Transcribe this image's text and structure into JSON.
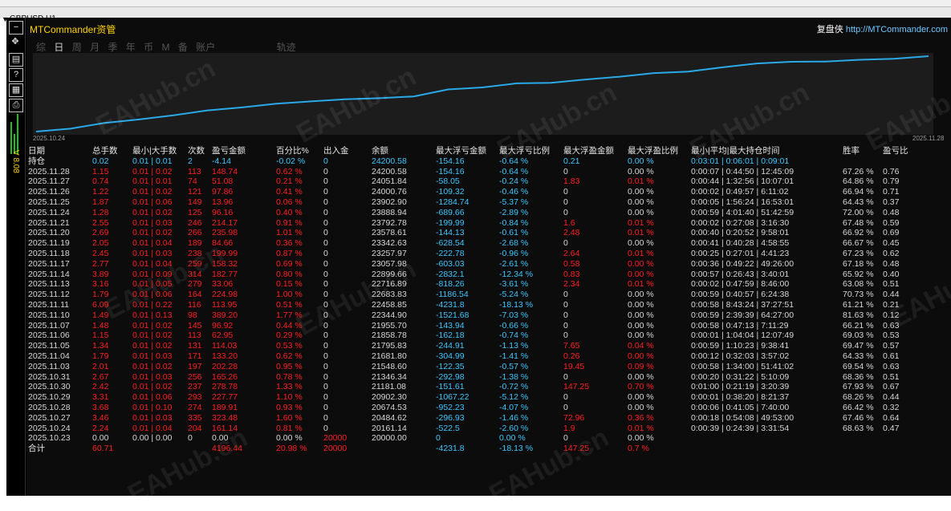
{
  "window": {
    "title": "GBPUSD,H1"
  },
  "app": {
    "title": "MTCommander资管",
    "brand_label": "复盘侠",
    "brand_url": "http://MTCommander.com",
    "version": "V 8.08"
  },
  "toolbar_icons": [
    "minimize-icon",
    "move-icon",
    "layout-icon",
    "help-icon",
    "settings-icon",
    "print-icon"
  ],
  "tabs": [
    "综",
    "日",
    "周",
    "月",
    "季",
    "年",
    "币",
    "M",
    "备",
    "账户",
    "轨迹"
  ],
  "active_tab": "日",
  "plot": {
    "start_date": "2025.10.24",
    "end_date": "2025.11.28",
    "line_color": "#29a9e8",
    "series": [
      20000,
      20161.14,
      20484.62,
      20674.53,
      20902.3,
      21181.08,
      21346.34,
      21548.6,
      21681.8,
      21795.83,
      21858.78,
      21955.7,
      22344.9,
      22458.85,
      22683.83,
      22716.89,
      22899.66,
      23057.98,
      23257.97,
      23342.63,
      23578.61,
      23792.78,
      23888.94,
      23902.9,
      24000.76,
      24051.84,
      24200.58
    ]
  },
  "watermark": "EAHub.cn",
  "headers": [
    "日期",
    "总手数",
    "最小|大手数",
    "次数",
    "盈亏金额",
    "百分比%",
    "出入金",
    "余额",
    "最大浮亏金额",
    "最大浮亏比例",
    "最大浮盈金额",
    "最大浮盈比例",
    "最小|平均|最大持仓时间",
    "胜率",
    "盈亏比"
  ],
  "holding": {
    "date": "持仓",
    "lots": "0.02",
    "minmax": "0.01 | 0.01",
    "count": "2",
    "pnl": "-4.14",
    "pct": "-0.02 %",
    "deposit": "0",
    "balance": "24200.58",
    "mfl": "-154.16",
    "mflp": "-0.64 %",
    "mfp": "0.21",
    "mfpp": "0.00 %",
    "hold": "0:03:01 | 0:06:01 | 0:09:01",
    "win": "",
    "pl": ""
  },
  "rows": [
    {
      "date": "2025.11.28",
      "lots": "1.15",
      "minmax": "0.01 | 0.02",
      "count": "113",
      "pnl": "148.74",
      "pct": "0.62 %",
      "deposit": "0",
      "balance": "24200.58",
      "mfl": "-154.16",
      "mflp": "-0.64 %",
      "mfp": "0",
      "mfpp": "0.00 %",
      "hold": "0:00:07 | 0:44:50 | 12:45:09",
      "win": "67.26 %",
      "pl": "0.76"
    },
    {
      "date": "2025.11.27",
      "lots": "0.74",
      "minmax": "0.01 | 0.01",
      "count": "74",
      "pnl": "51.08",
      "pct": "0.21 %",
      "deposit": "0",
      "balance": "24051.84",
      "mfl": "-58.05",
      "mflp": "-0.24 %",
      "mfp": "1.83",
      "mfpp": "0.01 %",
      "hold": "0:00:44 | 1:32:56 | 10:07:01",
      "win": "64.86 %",
      "pl": "0.79"
    },
    {
      "date": "2025.11.26",
      "lots": "1.22",
      "minmax": "0.01 | 0.02",
      "count": "121",
      "pnl": "97.86",
      "pct": "0.41 %",
      "deposit": "0",
      "balance": "24000.76",
      "mfl": "-109.32",
      "mflp": "-0.46 %",
      "mfp": "0",
      "mfpp": "0.00 %",
      "hold": "0:00:02 | 0:49:57 | 6:11:02",
      "win": "66.94 %",
      "pl": "0.71"
    },
    {
      "date": "2025.11.25",
      "lots": "1.87",
      "minmax": "0.01 | 0.06",
      "count": "149",
      "pnl": "13.96",
      "pct": "0.06 %",
      "deposit": "0",
      "balance": "23902.90",
      "mfl": "-1284.74",
      "mflp": "-5.37 %",
      "mfp": "0",
      "mfpp": "0.00 %",
      "hold": "0:00:05 | 1:56:24 | 16:53:01",
      "win": "64.43 %",
      "pl": "0.37"
    },
    {
      "date": "2025.11.24",
      "lots": "1.28",
      "minmax": "0.01 | 0.02",
      "count": "125",
      "pnl": "96.16",
      "pct": "0.40 %",
      "deposit": "0",
      "balance": "23888.94",
      "mfl": "-689.66",
      "mflp": "-2.89 %",
      "mfp": "0",
      "mfpp": "0.00 %",
      "hold": "0:00:59 | 4:01:40 | 51:42:59",
      "win": "72.00 %",
      "pl": "0.48"
    },
    {
      "date": "2025.11.21",
      "lots": "2.55",
      "minmax": "0.01 | 0.03",
      "count": "246",
      "pnl": "214.17",
      "pct": "0.91 %",
      "deposit": "0",
      "balance": "23792.78",
      "mfl": "-199.99",
      "mflp": "-0.84 %",
      "mfp": "1.6",
      "mfpp": "0.01 %",
      "hold": "0:00:02 | 0:27:08 | 3:16:30",
      "win": "67.48 %",
      "pl": "0.59"
    },
    {
      "date": "2025.11.20",
      "lots": "2.69",
      "minmax": "0.01 | 0.02",
      "count": "266",
      "pnl": "235.98",
      "pct": "1.01 %",
      "deposit": "0",
      "balance": "23578.61",
      "mfl": "-144.13",
      "mflp": "-0.61 %",
      "mfp": "2.48",
      "mfpp": "0.01 %",
      "hold": "0:00:40 | 0:20:52 | 9:58:01",
      "win": "66.92 %",
      "pl": "0.69"
    },
    {
      "date": "2025.11.19",
      "lots": "2.05",
      "minmax": "0.01 | 0.04",
      "count": "189",
      "pnl": "84.66",
      "pct": "0.36 %",
      "deposit": "0",
      "balance": "23342.63",
      "mfl": "-628.54",
      "mflp": "-2.68 %",
      "mfp": "0",
      "mfpp": "0.00 %",
      "hold": "0:00:41 | 0:40:28 | 4:58:55",
      "win": "66.67 %",
      "pl": "0.45"
    },
    {
      "date": "2025.11.18",
      "lots": "2.45",
      "minmax": "0.01 | 0.03",
      "count": "238",
      "pnl": "199.99",
      "pct": "0.87 %",
      "deposit": "0",
      "balance": "23257.97",
      "mfl": "-222.78",
      "mflp": "-0.96 %",
      "mfp": "2.64",
      "mfpp": "0.01 %",
      "hold": "0:00:25 | 0:27:01 | 4:41:23",
      "win": "67.23 %",
      "pl": "0.62"
    },
    {
      "date": "2025.11.17",
      "lots": "2.77",
      "minmax": "0.01 | 0.04",
      "count": "259",
      "pnl": "158.32",
      "pct": "0.69 %",
      "deposit": "0",
      "balance": "23057.98",
      "mfl": "-603.03",
      "mflp": "-2.61 %",
      "mfp": "0.58",
      "mfpp": "0.00 %",
      "hold": "0:00:36 | 0:49:22 | 49:26:00",
      "win": "67.18 %",
      "pl": "0.48"
    },
    {
      "date": "2025.11.14",
      "lots": "3.89",
      "minmax": "0.01 | 0.09",
      "count": "314",
      "pnl": "182.77",
      "pct": "0.80 %",
      "deposit": "0",
      "balance": "22899.66",
      "mfl": "-2832.1",
      "mflp": "-12.34 %",
      "mfp": "0.83",
      "mfpp": "0.00 %",
      "hold": "0:00:57 | 0:26:43 | 3:40:01",
      "win": "65.92 %",
      "pl": "0.40"
    },
    {
      "date": "2025.11.13",
      "lots": "3.16",
      "minmax": "0.01 | 0.05",
      "count": "279",
      "pnl": "33.06",
      "pct": "0.15 %",
      "deposit": "0",
      "balance": "22716.89",
      "mfl": "-818.26",
      "mflp": "-3.61 %",
      "mfp": "2.34",
      "mfpp": "0.01 %",
      "hold": "0:00:02 | 0:47:59 | 8:46:00",
      "win": "63.08 %",
      "pl": "0.51"
    },
    {
      "date": "2025.11.12",
      "lots": "1.79",
      "minmax": "0.01 | 0.06",
      "count": "164",
      "pnl": "224.98",
      "pct": "1.00 %",
      "deposit": "0",
      "balance": "22683.83",
      "mfl": "-1186.54",
      "mflp": "-5.24 %",
      "mfp": "0",
      "mfpp": "0.00 %",
      "hold": "0:00:59 | 0:40:57 | 6:24:38",
      "win": "70.73 %",
      "pl": "0.44"
    },
    {
      "date": "2025.11.11",
      "lots": "6.09",
      "minmax": "0.01 | 0.22",
      "count": "116",
      "pnl": "113.95",
      "pct": "0.51 %",
      "deposit": "0",
      "balance": "22458.85",
      "mfl": "-4231.8",
      "mflp": "-18.13 %",
      "mfp": "0",
      "mfpp": "0.00 %",
      "hold": "0:00:58 | 8:43:24 | 37:27:51",
      "win": "61.21 %",
      "pl": "0.21"
    },
    {
      "date": "2025.11.10",
      "lots": "1.49",
      "minmax": "0.01 | 0.13",
      "count": "98",
      "pnl": "389.20",
      "pct": "1.77 %",
      "deposit": "0",
      "balance": "22344.90",
      "mfl": "-1521.68",
      "mflp": "-7.03 %",
      "mfp": "0",
      "mfpp": "0.00 %",
      "hold": "0:00:59 | 2:39:39 | 64:27:00",
      "win": "81.63 %",
      "pl": "0.12"
    },
    {
      "date": "2025.11.07",
      "lots": "1.48",
      "minmax": "0.01 | 0.02",
      "count": "145",
      "pnl": "96.92",
      "pct": "0.44 %",
      "deposit": "0",
      "balance": "21955.70",
      "mfl": "-143.94",
      "mflp": "-0.66 %",
      "mfp": "0",
      "mfpp": "0.00 %",
      "hold": "0:00:58 | 0:47:13 | 7:11:29",
      "win": "66.21 %",
      "pl": "0.63"
    },
    {
      "date": "2025.11.06",
      "lots": "1.15",
      "minmax": "0.01 | 0.02",
      "count": "113",
      "pnl": "62.95",
      "pct": "0.29 %",
      "deposit": "0",
      "balance": "21858.78",
      "mfl": "-162.18",
      "mflp": "-0.74 %",
      "mfp": "0",
      "mfpp": "0.00 %",
      "hold": "0:00:01 | 1:04:04 | 12:07:49",
      "win": "69.03 %",
      "pl": "0.53"
    },
    {
      "date": "2025.11.05",
      "lots": "1.34",
      "minmax": "0.01 | 0.02",
      "count": "131",
      "pnl": "114.03",
      "pct": "0.53 %",
      "deposit": "0",
      "balance": "21795.83",
      "mfl": "-244.91",
      "mflp": "-1.13 %",
      "mfp": "7.65",
      "mfpp": "0.04 %",
      "hold": "0:00:59 | 1:10:23 | 9:38:41",
      "win": "69.47 %",
      "pl": "0.57"
    },
    {
      "date": "2025.11.04",
      "lots": "1.79",
      "minmax": "0.01 | 0.03",
      "count": "171",
      "pnl": "133.20",
      "pct": "0.62 %",
      "deposit": "0",
      "balance": "21681.80",
      "mfl": "-304.99",
      "mflp": "-1.41 %",
      "mfp": "0.26",
      "mfpp": "0.00 %",
      "hold": "0:00:12 | 0:32:03 | 3:57:02",
      "win": "64.33 %",
      "pl": "0.61"
    },
    {
      "date": "2025.11.03",
      "lots": "2.01",
      "minmax": "0.01 | 0.02",
      "count": "197",
      "pnl": "202.28",
      "pct": "0.95 %",
      "deposit": "0",
      "balance": "21548.60",
      "mfl": "-122.35",
      "mflp": "-0.57 %",
      "mfp": "19.45",
      "mfpp": "0.09 %",
      "hold": "0:00:58 | 1:34:00 | 51:41:02",
      "win": "69.54 %",
      "pl": "0.63"
    },
    {
      "date": "2025.10.31",
      "lots": "2.67",
      "minmax": "0.01 | 0.03",
      "count": "256",
      "pnl": "165.26",
      "pct": "0.78 %",
      "deposit": "0",
      "balance": "21346.34",
      "mfl": "-292.98",
      "mflp": "-1.38 %",
      "mfp": "0",
      "mfpp": "0.00 %",
      "hold": "0:00:20 | 0:31:22 | 5:10:09",
      "win": "68.36 %",
      "pl": "0.51"
    },
    {
      "date": "2025.10.30",
      "lots": "2.42",
      "minmax": "0.01 | 0.02",
      "count": "237",
      "pnl": "278.78",
      "pct": "1.33 %",
      "deposit": "0",
      "balance": "21181.08",
      "mfl": "-151.61",
      "mflp": "-0.72 %",
      "mfp": "147.25",
      "mfpp": "0.70 %",
      "hold": "0:01:00 | 0:21:19 | 3:20:39",
      "win": "67.93 %",
      "pl": "0.67"
    },
    {
      "date": "2025.10.29",
      "lots": "3.31",
      "minmax": "0.01 | 0.06",
      "count": "293",
      "pnl": "227.77",
      "pct": "1.10 %",
      "deposit": "0",
      "balance": "20902.30",
      "mfl": "-1067.22",
      "mflp": "-5.12 %",
      "mfp": "0",
      "mfpp": "0.00 %",
      "hold": "0:00:01 | 0:38:20 | 8:21:37",
      "win": "68.26 %",
      "pl": "0.44"
    },
    {
      "date": "2025.10.28",
      "lots": "3.68",
      "minmax": "0.01 | 0.10",
      "count": "274",
      "pnl": "189.91",
      "pct": "0.93 %",
      "deposit": "0",
      "balance": "20674.53",
      "mfl": "-952.23",
      "mflp": "-4.07 %",
      "mfp": "0",
      "mfpp": "0.00 %",
      "hold": "0:00:06 | 0:41:05 | 7:40:00",
      "win": "66.42 %",
      "pl": "0.32"
    },
    {
      "date": "2025.10.27",
      "lots": "3.46",
      "minmax": "0.01 | 0.03",
      "count": "335",
      "pnl": "323.48",
      "pct": "1.60 %",
      "deposit": "0",
      "balance": "20484.62",
      "mfl": "-296.93",
      "mflp": "-1.46 %",
      "mfp": "72.96",
      "mfpp": "0.36 %",
      "hold": "0:00:18 | 0:54:08 | 49:53:00",
      "win": "67.46 %",
      "pl": "0.64"
    },
    {
      "date": "2025.10.24",
      "lots": "2.24",
      "minmax": "0.01 | 0.04",
      "count": "204",
      "pnl": "161.14",
      "pct": "0.81 %",
      "deposit": "0",
      "balance": "20161.14",
      "mfl": "-522.5",
      "mflp": "-2.60 %",
      "mfp": "1.9",
      "mfpp": "0.01 %",
      "hold": "0:00:39 | 0:24:39 | 3:31:54",
      "win": "68.63 %",
      "pl": "0.47"
    },
    {
      "date": "2025.10.23",
      "lots": "0.00",
      "minmax": "0.00 | 0.00",
      "count": "0",
      "pnl": "0.00",
      "pct": "0.00 %",
      "deposit": "20000",
      "balance": "20000.00",
      "mfl": "0",
      "mflp": "0.00 %",
      "mfp": "0",
      "mfpp": "0.00 %",
      "hold": "",
      "win": "",
      "pl": ""
    }
  ],
  "total": {
    "date": "合计",
    "lots": "60.71",
    "minmax": "",
    "count": "",
    "pnl": "4196.44",
    "pct": "20.98 %",
    "deposit": "20000",
    "balance": "",
    "mfl": "-4231.8",
    "mflp": "-18.13 %",
    "mfp": "147.25",
    "mfpp": "0.7 %",
    "hold": "",
    "win": "",
    "pl": ""
  }
}
